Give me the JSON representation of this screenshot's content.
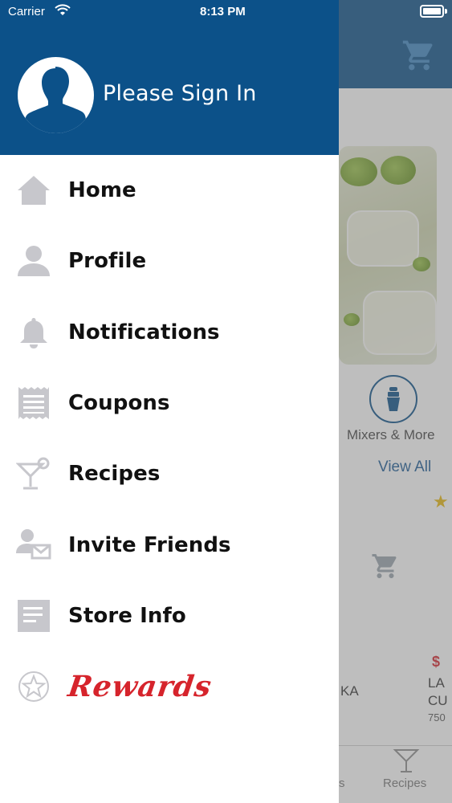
{
  "status_bar": {
    "carrier": "Carrier",
    "time": "8:13 PM"
  },
  "drawer": {
    "header": {
      "sign_in_text": "Please Sign In",
      "background_color": "#0c5189"
    },
    "items": [
      {
        "label": "Home",
        "icon": "home-icon"
      },
      {
        "label": "Profile",
        "icon": "profile-icon"
      },
      {
        "label": "Notifications",
        "icon": "bell-icon"
      },
      {
        "label": "Coupons",
        "icon": "coupon-icon"
      },
      {
        "label": "Recipes",
        "icon": "cocktail-icon"
      },
      {
        "label": "Invite Friends",
        "icon": "invite-friends-icon"
      },
      {
        "label": "Store Info",
        "icon": "store-info-icon"
      }
    ],
    "rewards": {
      "label": "Rewards",
      "icon": "star-icon",
      "color": "#d6242c"
    }
  },
  "background_app": {
    "category_label": "Mixers & More",
    "view_all": "View All",
    "price_fragment": "$",
    "product_fragment_1": "KA",
    "product_fragment_2": "LA\nCU",
    "product_size_fragment": "750",
    "tab_label": "Recipes",
    "tab_label_partial": "s"
  },
  "colors": {
    "accent": "#0c5189",
    "icon_gray": "#c7c7cc",
    "rewards_red": "#d6242c"
  }
}
